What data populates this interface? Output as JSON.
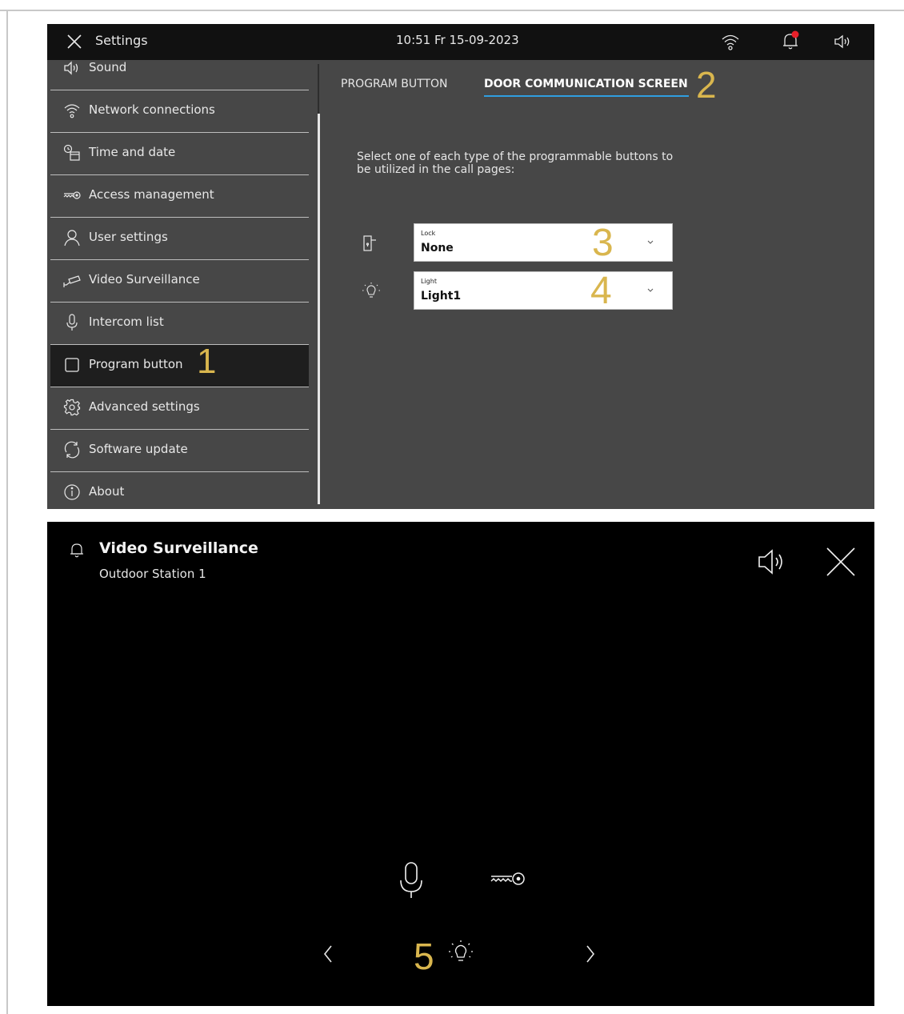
{
  "settings": {
    "title": "Settings",
    "datetime": "10:51  Fr 15-09-2023",
    "sidebar": [
      {
        "label": "Sound",
        "icon": "speaker-icon"
      },
      {
        "label": "Network connections",
        "icon": "wifi-icon"
      },
      {
        "label": "Time and date",
        "icon": "clock-calendar-icon"
      },
      {
        "label": "Access  management",
        "icon": "key-icon"
      },
      {
        "label": "User settings",
        "icon": "user-icon"
      },
      {
        "label": "Video Surveillance",
        "icon": "camera-icon"
      },
      {
        "label": "Intercom list",
        "icon": "microphone-icon"
      },
      {
        "label": "Program button",
        "icon": "square-icon",
        "active": true
      },
      {
        "label": "Advanced settings",
        "icon": "gear-icon"
      },
      {
        "label": "Software update",
        "icon": "refresh-icon"
      },
      {
        "label": "About",
        "icon": "info-icon"
      }
    ],
    "tabs": [
      {
        "label": "PROGRAM BUTTON",
        "active": false
      },
      {
        "label": "DOOR COMMUNICATION SCREEN",
        "active": true
      }
    ],
    "description": "Select one of each type of the programmable buttons to be utilized in the call pages:",
    "dropdowns": [
      {
        "caption": "Lock",
        "value": "None",
        "icon": "door-lock-icon"
      },
      {
        "caption": "Light",
        "value": "Light1",
        "icon": "light-bulb-icon"
      }
    ],
    "accent_color": "#2f9ee0",
    "notification_dot_color": "#e8202a"
  },
  "video": {
    "title": "Video Surveillance",
    "subtitle": "Outdoor Station 1"
  },
  "markers": [
    "1",
    "2",
    "3",
    "4",
    "5"
  ],
  "marker_color": "#d9b64e"
}
